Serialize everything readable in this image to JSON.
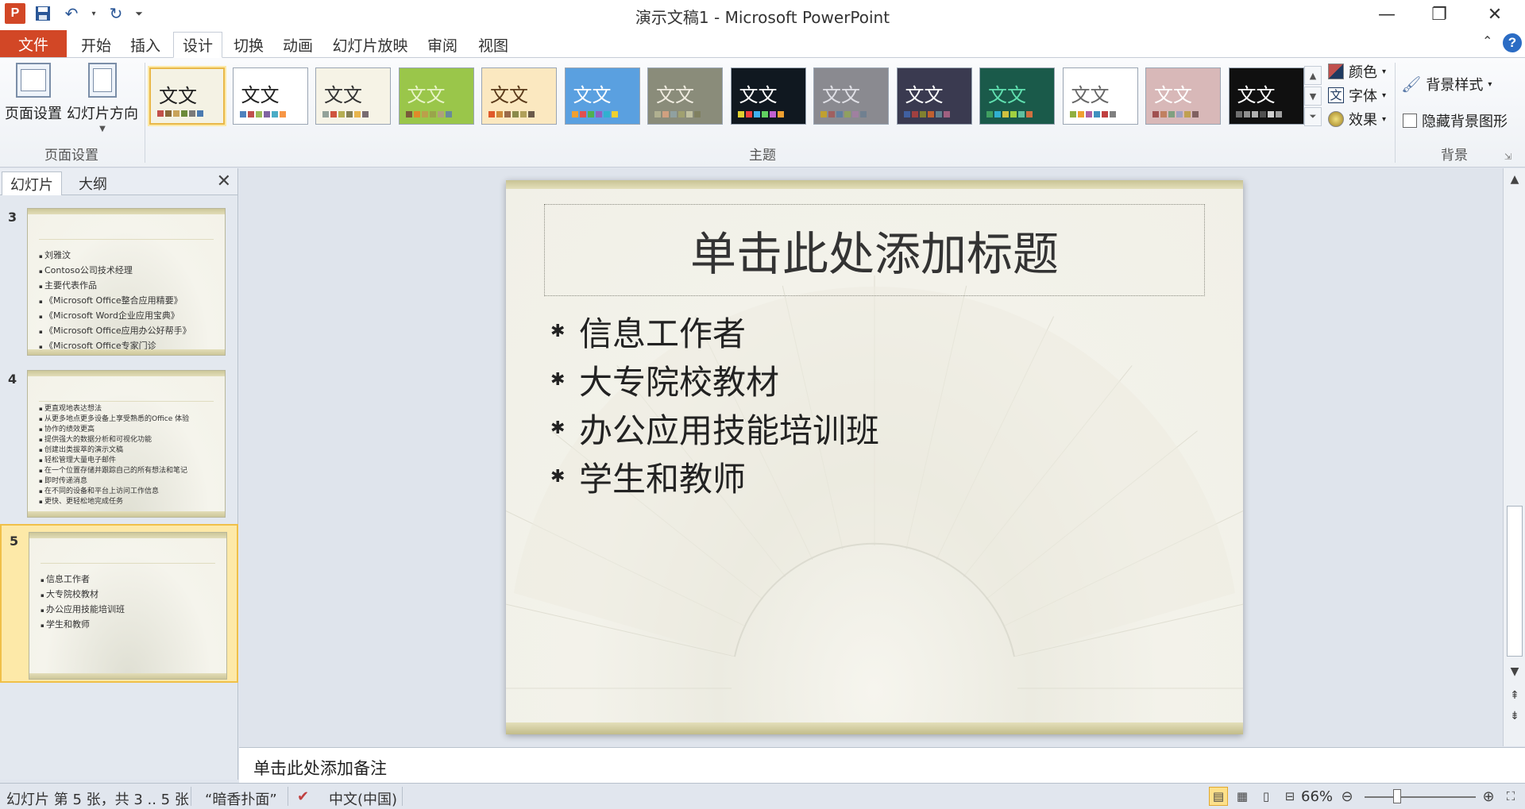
{
  "window": {
    "title": "演示文稿1 - Microsoft PowerPoint",
    "app_icon_letter": "P",
    "controls": [
      "minimize-icon",
      "restore-icon",
      "close-icon"
    ]
  },
  "tabs": {
    "file": "文件",
    "items": [
      "开始",
      "插入",
      "设计",
      "切换",
      "动画",
      "幻灯片放映",
      "审阅",
      "视图"
    ],
    "active": "设计"
  },
  "ribbon": {
    "page_setup_group": {
      "label": "页面设置",
      "page_setup_button": "页面设置",
      "orientation_button": "幻灯片方向"
    },
    "themes_group": {
      "label": "主题",
      "sample_text": "文文",
      "themes": [
        {
          "bg": "#f4f2e4",
          "fg": "#222222",
          "selected": true,
          "dots": [
            "#c2504a",
            "#8a6a3a",
            "#c9a35a",
            "#6b8a3a",
            "#7a7a7a",
            "#4a7ab0"
          ]
        },
        {
          "bg": "#ffffff",
          "fg": "#222222",
          "selected": false,
          "dots": [
            "#4f81bd",
            "#c0504d",
            "#9bbb59",
            "#8064a2",
            "#4bacc6",
            "#f79646"
          ]
        },
        {
          "bg": "#f6f3e6",
          "fg": "#333333",
          "selected": false,
          "dots": [
            "#93a299",
            "#cf543f",
            "#b5ae53",
            "#848058",
            "#e8b54d",
            "#786c71"
          ]
        },
        {
          "bg": "#9ac64a",
          "fg": "#e8f4c8",
          "selected": false,
          "dots": [
            "#7a5a3a",
            "#e08a2a",
            "#bba04a",
            "#9aa44a",
            "#b0a07a",
            "#6a8a9a"
          ]
        },
        {
          "bg": "#fbe8c0",
          "fg": "#5a3a1a",
          "selected": false,
          "dots": [
            "#e05a2a",
            "#d08a3a",
            "#9a6a4a",
            "#8a8a4a",
            "#b0a05a",
            "#6a5a4a"
          ]
        },
        {
          "bg": "#5aa0e0",
          "fg": "#ffffff",
          "selected": false,
          "dots": [
            "#f0a030",
            "#e05050",
            "#50b050",
            "#9060c0",
            "#30b0d0",
            "#f0d030"
          ]
        },
        {
          "bg": "#8a8c7a",
          "fg": "#f0ece0",
          "selected": false,
          "dots": [
            "#b0b090",
            "#d0a080",
            "#90a0a0",
            "#a0a070",
            "#c0c0a0",
            "#808060"
          ]
        },
        {
          "bg": "#101820",
          "fg": "#ffffff",
          "selected": false,
          "dots": [
            "#e0d030",
            "#f04040",
            "#40b0f0",
            "#60d060",
            "#c060d0",
            "#f0a030"
          ]
        },
        {
          "bg": "#8a8a90",
          "fg": "#e0e0e6",
          "selected": false,
          "dots": [
            "#c0a030",
            "#a06060",
            "#6080a0",
            "#90a060",
            "#a080a0",
            "#708090"
          ]
        },
        {
          "bg": "#3a3a50",
          "fg": "#ffffff",
          "selected": false,
          "dots": [
            "#4060a0",
            "#a04040",
            "#808030",
            "#c06030",
            "#608090",
            "#a06080"
          ]
        },
        {
          "bg": "#1a5a4a",
          "fg": "#60e0b0",
          "selected": false,
          "dots": [
            "#40a060",
            "#30b0d0",
            "#d0c040",
            "#a0d040",
            "#60c0a0",
            "#d07040"
          ]
        },
        {
          "bg": "#ffffff",
          "fg": "#666666",
          "selected": false,
          "dots": [
            "#90b040",
            "#f0a030",
            "#b060a0",
            "#4090c0",
            "#c04040",
            "#808080"
          ]
        },
        {
          "bg": "#d8b8b8",
          "fg": "#ffffff",
          "selected": false,
          "dots": [
            "#a05050",
            "#c08060",
            "#80a080",
            "#a0a0c0",
            "#c0a050",
            "#806060"
          ]
        },
        {
          "bg": "#101010",
          "fg": "#ffffff",
          "selected": false,
          "dots": [
            "#707070",
            "#909090",
            "#b0b0b0",
            "#505050",
            "#d0d0d0",
            "#a0a0a0"
          ]
        }
      ],
      "colors_label": "颜色",
      "fonts_label": "字体",
      "effects_label": "效果"
    },
    "background_group": {
      "label": "背景",
      "styles_button": "背景样式",
      "hide_graphics_label": "隐藏背景图形",
      "hide_graphics_checked": false
    }
  },
  "left_panel": {
    "tabs": [
      "幻灯片",
      "大纲"
    ],
    "active_tab": "幻灯片",
    "slides": [
      {
        "number": "3",
        "selected": false,
        "bullets": [
          "刘雅汶",
          "Contoso公司技术经理",
          "主要代表作品",
          "《Microsoft Office整合应用精要》",
          "《Microsoft Word企业应用宝典》",
          "《Microsoft Office应用办公好帮手》",
          "《Microsoft Office专家门诊"
        ]
      },
      {
        "number": "4",
        "selected": false,
        "bullets": [
          "更直观地表达想法",
          "从更多地点更多设备上享受熟悉的Office 体验",
          "协作的绩效更高",
          "提供强大的数据分析和可视化功能",
          "创建出类拔萃的演示文稿",
          "轻松管理大量电子邮件",
          "在一个位置存储并跟踪自己的所有想法和笔记",
          "即时传递消息",
          "在不同的设备和平台上访问工作信息",
          "更快、更轻松地完成任务"
        ]
      },
      {
        "number": "5",
        "selected": true,
        "bullets": [
          "信息工作者",
          "大专院校教材",
          "办公应用技能培训班",
          "学生和教师"
        ]
      }
    ]
  },
  "slide": {
    "title_placeholder": "单击此处添加标题",
    "bullet_glyph": "✱",
    "bullets": [
      "信息工作者",
      "大专院校教材",
      "办公应用技能培训班",
      "学生和教师"
    ]
  },
  "notes": {
    "placeholder": "单击此处添加备注"
  },
  "status": {
    "slide_info": "幻灯片 第 5 张，共 3 .. 5 张",
    "theme_name": "“暗香扑面”",
    "language": "中文(中国)",
    "zoom": "66%"
  }
}
